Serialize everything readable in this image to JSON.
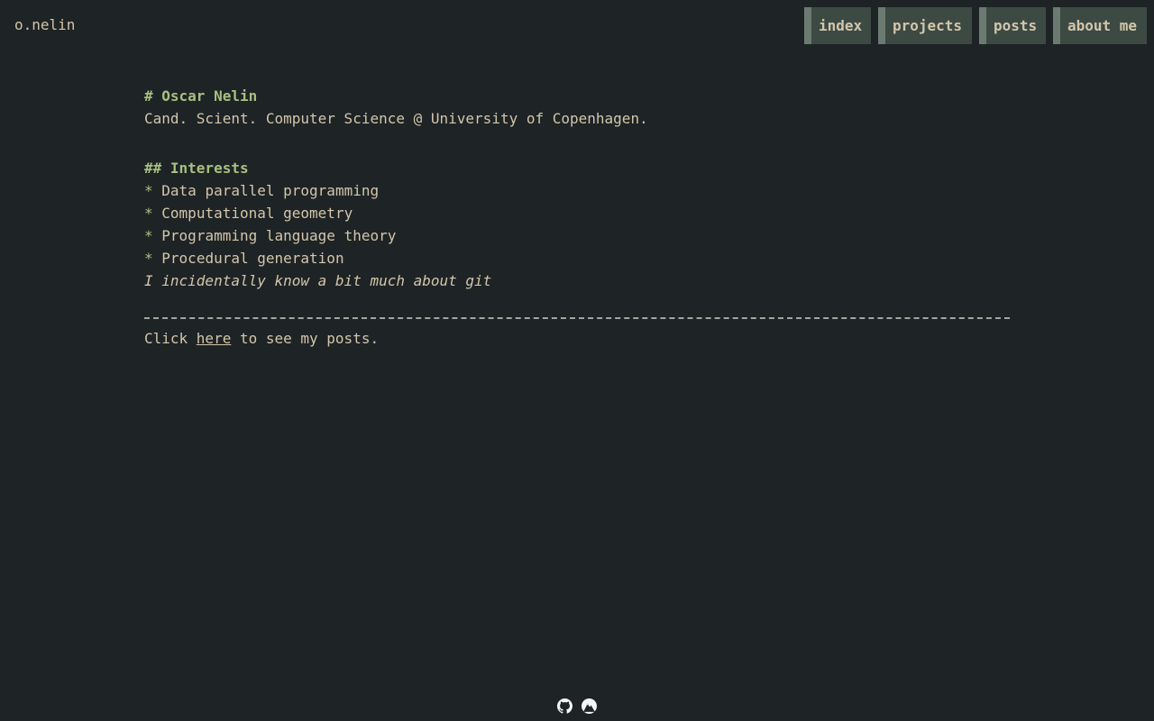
{
  "site": {
    "brand": "o.nelin"
  },
  "nav": {
    "items": [
      {
        "label": "index"
      },
      {
        "label": "projects"
      },
      {
        "label": "posts"
      },
      {
        "label": "about me"
      }
    ]
  },
  "content": {
    "title": "# Oscar Nelin",
    "subtitle": "Cand. Scient. Computer Science @ University of Copenhagen.",
    "interests_heading": "## Interests",
    "bullet_marker": "*",
    "interests": [
      "Data parallel programming",
      "Computational geometry",
      "Programming language theory",
      "Procedural generation"
    ],
    "note": "I incidentally know a bit much about git",
    "cta_prefix": "Click ",
    "cta_link": "here",
    "cta_suffix": " to see my posts."
  },
  "footer": {
    "icons": [
      "github-icon",
      "mountain-icon"
    ]
  },
  "colors": {
    "background": "#1e2326",
    "text": "#d3c6aa",
    "accent": "#a7c080",
    "nav_bg": "#3d4a44",
    "nav_border": "#6b7b72"
  }
}
